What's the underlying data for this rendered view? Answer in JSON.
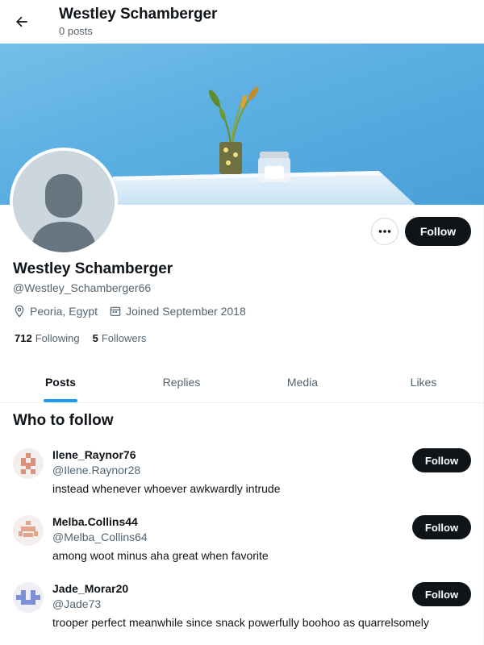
{
  "header": {
    "title": "Westley Schamberger",
    "subtitle": "0 posts"
  },
  "profile": {
    "display_name": "Westley Schamberger",
    "handle": "@Westley_Schamberger66",
    "location": "Peoria, Egypt",
    "joined": "Joined September 2018",
    "following_count": "712",
    "following_label": "Following",
    "followers_count": "5",
    "followers_label": "Followers",
    "follow_label": "Follow"
  },
  "tabs": [
    {
      "label": "Posts",
      "active": true
    },
    {
      "label": "Replies",
      "active": false
    },
    {
      "label": "Media",
      "active": false
    },
    {
      "label": "Likes",
      "active": false
    }
  ],
  "who_to_follow": {
    "title": "Who to follow",
    "follow_label": "Follow",
    "users": [
      {
        "name": "Ilene_Raynor76",
        "handle": "@Ilene.Raynor28",
        "bio": "instead whenever whoever awkwardly intrude",
        "avatar_color": "#d9937d"
      },
      {
        "name": "Melba.Collins44",
        "handle": "@Melba_Collins64",
        "bio": "among woot minus aha great when favorite",
        "avatar_color": "#e0a58a"
      },
      {
        "name": "Jade_Morar20",
        "handle": "@Jade73",
        "bio": "trooper perfect meanwhile since snack powerfully boohoo as quarrelsomely",
        "avatar_color": "#7f8fd6"
      }
    ]
  },
  "colors": {
    "accent": "#1d9bf0",
    "text_primary": "#0f1419",
    "text_secondary": "#536471",
    "banner_wall": "#5fb2e2"
  }
}
